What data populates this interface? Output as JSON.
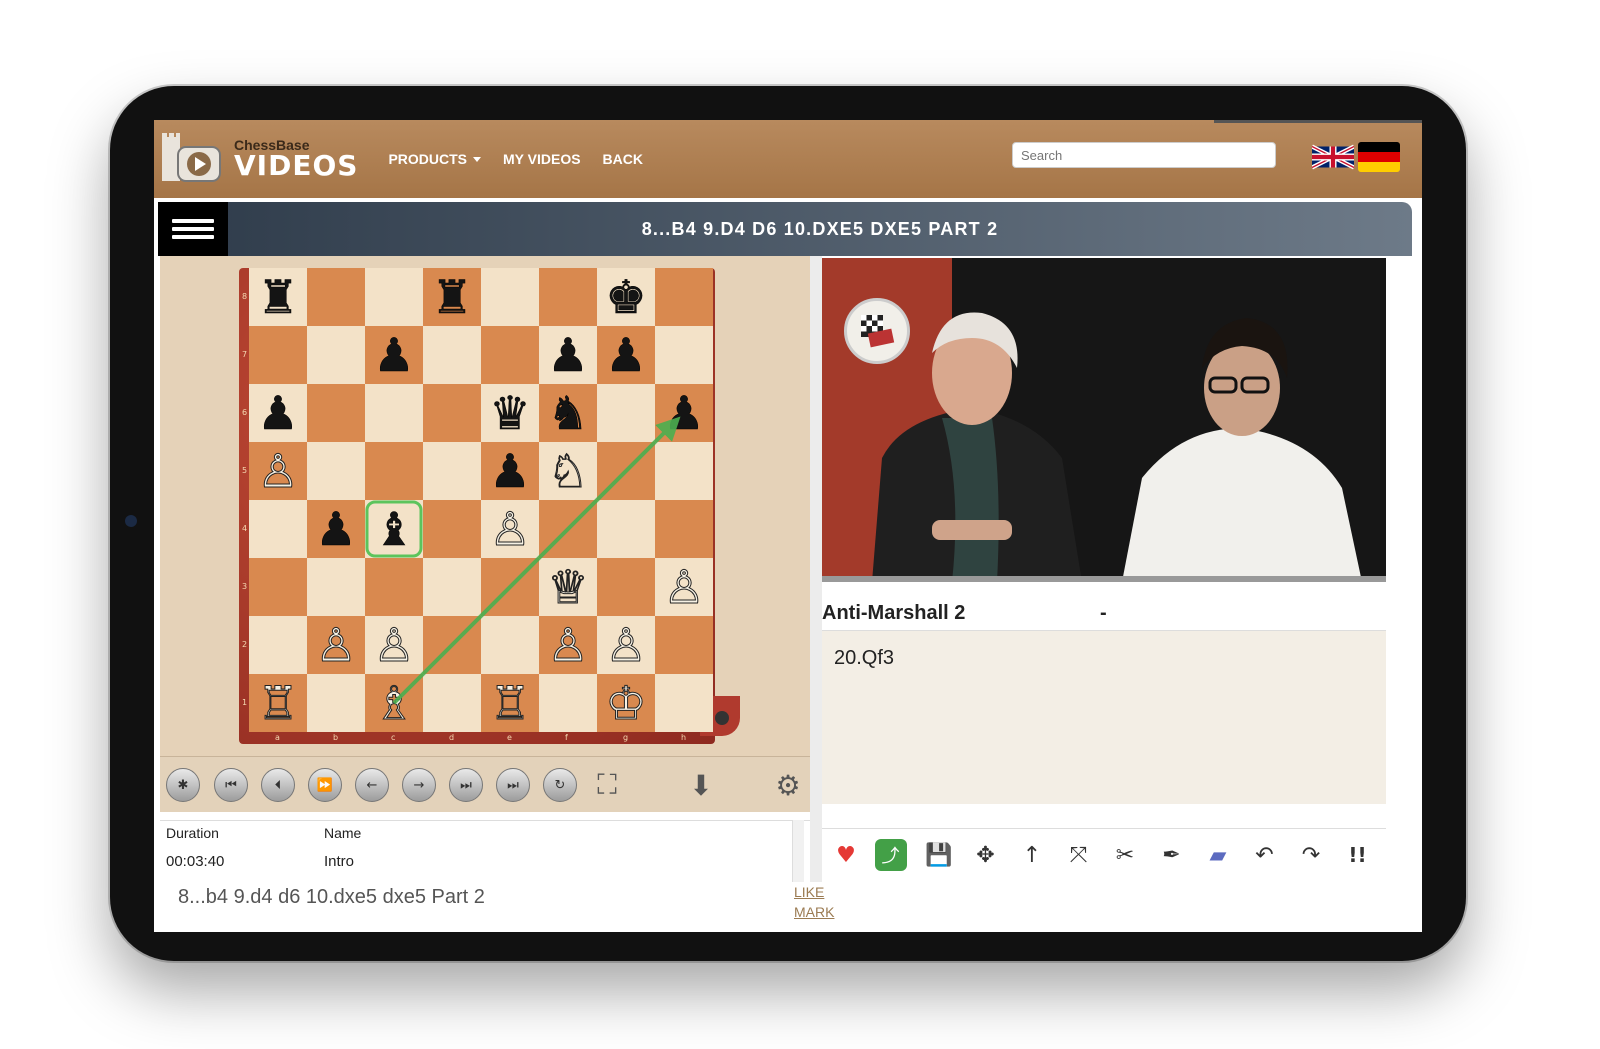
{
  "header": {
    "brand_small": "ChessBase",
    "brand_large": "VIDEOS",
    "nav": [
      {
        "label": "PRODUCTS",
        "has_caret": true
      },
      {
        "label": "MY VIDEOS",
        "has_caret": false
      },
      {
        "label": "BACK",
        "has_caret": false
      }
    ],
    "search_placeholder": "Search",
    "languages": [
      "English",
      "Deutsch"
    ]
  },
  "title": "8...B4 9.D4 D6 10.DXE5 DXE5 PART 2",
  "board": {
    "files": [
      "a",
      "b",
      "c",
      "d",
      "e",
      "f",
      "g",
      "h"
    ],
    "ranks": [
      "8",
      "7",
      "6",
      "5",
      "4",
      "3",
      "2",
      "1"
    ],
    "pieces": [
      {
        "square": "a8",
        "piece": "r"
      },
      {
        "square": "d8",
        "piece": "r"
      },
      {
        "square": "g8",
        "piece": "k"
      },
      {
        "square": "c7",
        "piece": "p"
      },
      {
        "square": "f7",
        "piece": "p"
      },
      {
        "square": "g7",
        "piece": "p"
      },
      {
        "square": "a6",
        "piece": "p"
      },
      {
        "square": "e6",
        "piece": "q"
      },
      {
        "square": "f6",
        "piece": "n"
      },
      {
        "square": "h6",
        "piece": "p"
      },
      {
        "square": "a5",
        "piece": "P"
      },
      {
        "square": "e5",
        "piece": "p"
      },
      {
        "square": "f5",
        "piece": "N"
      },
      {
        "square": "b4",
        "piece": "p"
      },
      {
        "square": "c4",
        "piece": "b"
      },
      {
        "square": "e4",
        "piece": "P"
      },
      {
        "square": "f3",
        "piece": "Q"
      },
      {
        "square": "h3",
        "piece": "P"
      },
      {
        "square": "b2",
        "piece": "P"
      },
      {
        "square": "c2",
        "piece": "P"
      },
      {
        "square": "f2",
        "piece": "P"
      },
      {
        "square": "g2",
        "piece": "P"
      },
      {
        "square": "a1",
        "piece": "R"
      },
      {
        "square": "c1",
        "piece": "B"
      },
      {
        "square": "e1",
        "piece": "R"
      },
      {
        "square": "g1",
        "piece": "K"
      }
    ],
    "highlight": "c4",
    "arrow": {
      "from": "c1",
      "to": "h6"
    },
    "colors": {
      "light": "#f3e2c8",
      "dark": "#d9894f",
      "frame": "#b03a2e",
      "arrow": "#4caf50"
    }
  },
  "controls": [
    {
      "name": "engine-wheel-icon",
      "glyph": "✱"
    },
    {
      "name": "first-move-icon",
      "glyph": "⏮"
    },
    {
      "name": "prev-move-icon",
      "glyph": "⏴"
    },
    {
      "name": "fast-forward-icon",
      "glyph": "⏩"
    },
    {
      "name": "back-arrow-icon",
      "glyph": "←"
    },
    {
      "name": "forward-arrow-icon",
      "glyph": "→"
    },
    {
      "name": "next-move-icon",
      "glyph": "⏭"
    },
    {
      "name": "last-move-icon",
      "glyph": "⏭"
    },
    {
      "name": "flip-board-icon",
      "glyph": "↻"
    },
    {
      "name": "fullscreen-icon",
      "glyph": "⛶"
    },
    {
      "name": "download-icon",
      "glyph": "⬇"
    },
    {
      "name": "settings-icon",
      "glyph": "⚙"
    }
  ],
  "table": {
    "headers": [
      "Duration",
      "Name"
    ],
    "rows": [
      [
        "00:03:40",
        "Intro"
      ]
    ]
  },
  "footer": {
    "title": "8...b4 9.d4 d6 10.dxe5 dxe5 Part 2",
    "like": "LIKE",
    "mark": "MARK"
  },
  "panel": {
    "section_name": "Anti-Marshall 2",
    "section_sep": "-",
    "current_move": "20.Qf3"
  },
  "tools": [
    {
      "name": "like-heart-icon",
      "glyph": "♥",
      "color": "#e53935"
    },
    {
      "name": "share-icon",
      "glyph": "⤴",
      "color": "#43a047"
    },
    {
      "name": "save-icon",
      "glyph": "💾",
      "color": "#333333"
    },
    {
      "name": "move-arrows-icon",
      "glyph": "✥",
      "color": "#333333"
    },
    {
      "name": "up-arrow-icon",
      "glyph": "↑",
      "color": "#333333"
    },
    {
      "name": "delete-arrows-icon",
      "glyph": "⤧",
      "color": "#333333"
    },
    {
      "name": "knife-icon",
      "glyph": "✂",
      "color": "#333333"
    },
    {
      "name": "pen-icon",
      "glyph": "✒",
      "color": "#333333"
    },
    {
      "name": "eraser-icon",
      "glyph": "▰",
      "color": "#5c6bc0"
    },
    {
      "name": "undo-icon",
      "glyph": "↶",
      "color": "#333333"
    },
    {
      "name": "redo-icon",
      "glyph": "↷",
      "color": "#333333"
    },
    {
      "name": "annotation-icon",
      "glyph": "!!",
      "color": "#333333"
    }
  ]
}
